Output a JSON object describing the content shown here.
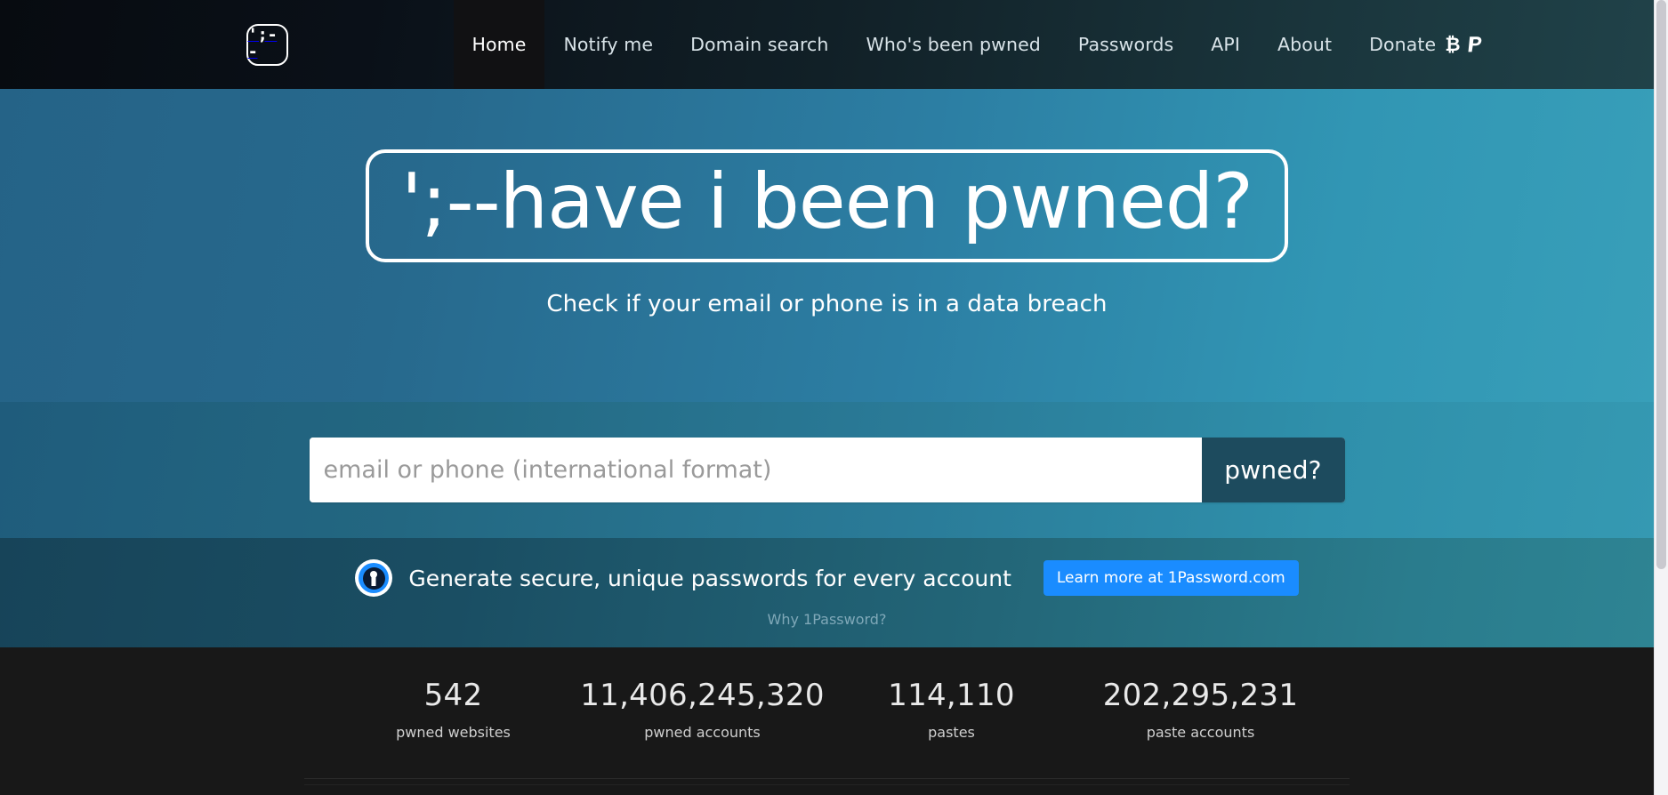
{
  "site": {
    "logo_text": "';--",
    "logo_name": "have-i-been-pwned-logo"
  },
  "nav": {
    "items": [
      {
        "label": "Home",
        "active": true
      },
      {
        "label": "Notify me",
        "active": false
      },
      {
        "label": "Domain search",
        "active": false
      },
      {
        "label": "Who's been pwned",
        "active": false
      },
      {
        "label": "Passwords",
        "active": false
      },
      {
        "label": "API",
        "active": false
      },
      {
        "label": "About",
        "active": false
      },
      {
        "label": "Donate",
        "active": false
      }
    ],
    "donate_icons": [
      "bitcoin-icon",
      "paypal-icon"
    ]
  },
  "hero": {
    "title": "';--have i been pwned?",
    "subtitle": "Check if your email or phone is in a data breach"
  },
  "search": {
    "placeholder": "email or phone (international format)",
    "value": "",
    "button_label": "pwned?"
  },
  "promo": {
    "icon": "1password-icon",
    "text": "Generate secure, unique passwords for every account",
    "button_label": "Learn more at 1Password.com",
    "link_label": "Why 1Password?"
  },
  "stats": [
    {
      "value": "542",
      "label": "pwned websites"
    },
    {
      "value": "11,406,245,320",
      "label": "pwned accounts"
    },
    {
      "value": "114,110",
      "label": "pastes"
    },
    {
      "value": "202,295,231",
      "label": "paste accounts"
    }
  ],
  "colors": {
    "header_dark": "#070b10",
    "header_teal": "#204249",
    "hero_blue_left": "#256387",
    "hero_blue_right": "#389fb9",
    "accent_blue": "#1a8cff",
    "pwned_button": "#1d4b5e",
    "stats_bg": "#181818"
  }
}
